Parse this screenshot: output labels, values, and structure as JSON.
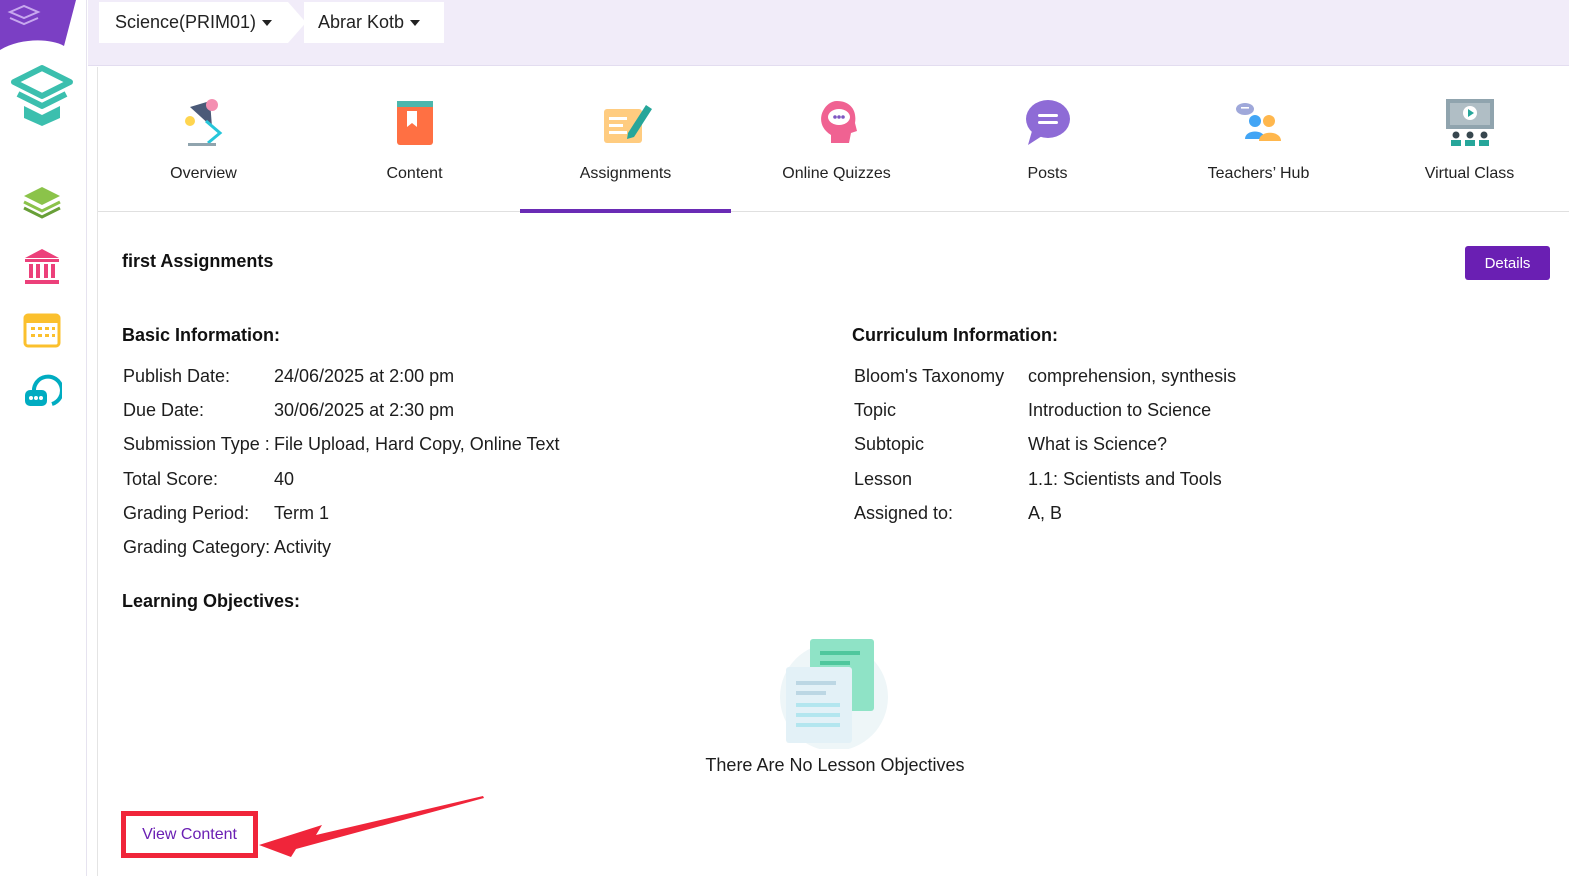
{
  "topbar": {
    "subject": "Science(PRIM01)",
    "teacher": "Abrar Kotb"
  },
  "sidebar": {
    "items": [
      {
        "icon": "layers-icon",
        "color": "#8bc34a"
      },
      {
        "icon": "institution-icon",
        "color": "#ec407a"
      },
      {
        "icon": "calendar-icon",
        "color": "#fbc02d"
      },
      {
        "icon": "chat-icon",
        "color": "#00acc1"
      }
    ]
  },
  "tabs": [
    {
      "label": "Overview",
      "icon": "lamp-icon"
    },
    {
      "label": "Content",
      "icon": "book-icon"
    },
    {
      "label": "Assignments",
      "icon": "pen-paper-icon",
      "active": true
    },
    {
      "label": "Online Quizzes",
      "icon": "head-chat-icon"
    },
    {
      "label": "Posts",
      "icon": "speech-bubble-icon"
    },
    {
      "label": "Teachers’ Hub",
      "icon": "people-icon"
    },
    {
      "label": "Virtual Class",
      "icon": "classroom-screen-icon"
    }
  ],
  "assignment": {
    "title": "first Assignments",
    "details_label": "Details",
    "basic_heading": "Basic Information:",
    "basic": [
      {
        "key": "Publish Date:",
        "value": "24/06/2025 at 2:00 pm"
      },
      {
        "key": "Due Date:",
        "value": "30/06/2025 at 2:30 pm"
      },
      {
        "key": "Submission Type :",
        "value": "File Upload, Hard Copy, Online Text"
      },
      {
        "key": "Total Score:",
        "value": "40"
      },
      {
        "key": "Grading Period:",
        "value": "Term 1"
      },
      {
        "key": "Grading Category:",
        "value": "Activity"
      }
    ],
    "curriculum_heading": "Curriculum Information:",
    "curriculum": [
      {
        "key": "Bloom's Taxonomy",
        "value": "comprehension, synthesis"
      },
      {
        "key": "Topic",
        "value": "Introduction to Science"
      },
      {
        "key": "Subtopic",
        "value": "What is Science?"
      },
      {
        "key": "Lesson",
        "value": "1.1: Scientists and Tools"
      },
      {
        "key": "Assigned to:",
        "value": "A, B"
      }
    ],
    "objectives_heading": "Learning Objectives:",
    "empty_objectives": "There Are No Lesson Objectives",
    "view_content_label": "View Content"
  },
  "colors": {
    "accent": "#6a1fb3",
    "highlight": "#f0253a",
    "topbar_bg": "#f1ecf9"
  }
}
